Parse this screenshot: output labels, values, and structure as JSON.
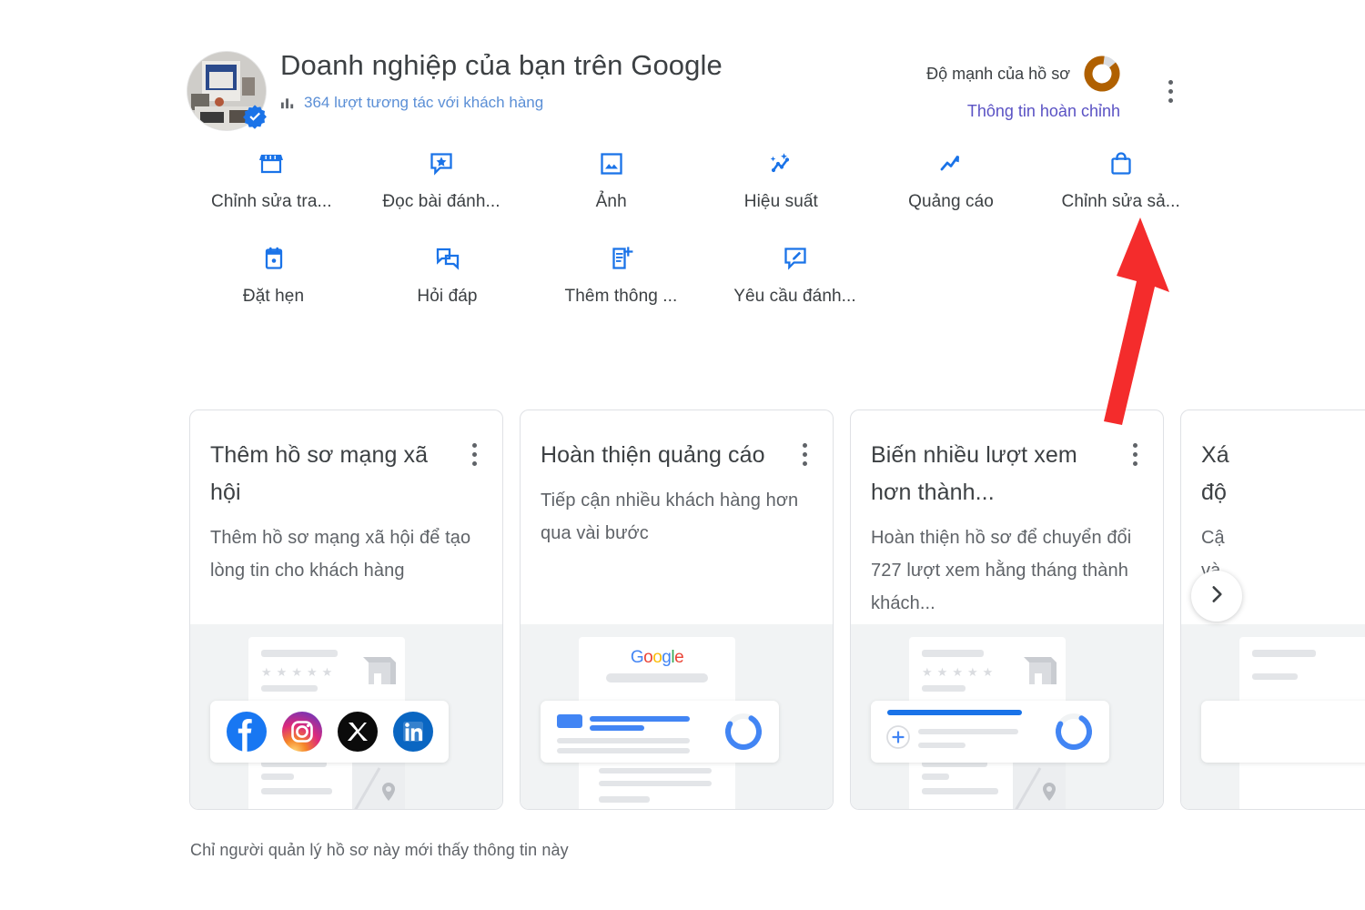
{
  "header": {
    "title": "Doanh nghiệp của bạn trên Google",
    "interactions_text": "364 lượt tương tác với khách hàng",
    "bars_icon": "bar-chart-icon",
    "verified_icon": "verified-badge-icon",
    "avatar_alt": "business-profile-photo",
    "strength_label": "Độ mạnh của hồ sơ",
    "strength_link": "Thông tin hoàn chỉnh",
    "strength_ring_color": "#B06000",
    "strength_ring_track": "#DADCE0",
    "strength_percent": 88,
    "kebab_icon": "more-options-icon"
  },
  "actions": {
    "row1": [
      {
        "label": "Chỉnh sửa tra...",
        "icon": "storefront-icon"
      },
      {
        "label": "Đọc bài đánh...",
        "icon": "review-star-bubble-icon"
      },
      {
        "label": "Ảnh",
        "icon": "photo-icon"
      },
      {
        "label": "Hiệu suất",
        "icon": "performance-sparkle-icon"
      },
      {
        "label": "Quảng cáo",
        "icon": "trending-up-icon"
      },
      {
        "label": "Chỉnh sửa sả...",
        "icon": "shopping-bag-icon"
      }
    ],
    "row2": [
      {
        "label": "Đặt hẹn",
        "icon": "calendar-icon"
      },
      {
        "label": "Hỏi đáp",
        "icon": "question-answer-icon"
      },
      {
        "label": "Thêm thông ...",
        "icon": "add-note-icon"
      },
      {
        "label": "Yêu cầu đánh...",
        "icon": "request-review-icon"
      }
    ],
    "icon_color": "#1a73e8"
  },
  "cards": [
    {
      "title": "Thêm hồ sơ mạng xã hội",
      "desc": "Thêm hồ sơ mạng xã hội để tạo lòng tin cho khách hàng",
      "illustration": "social-profiles-illustration",
      "socials": [
        "facebook-icon",
        "instagram-icon",
        "x-twitter-icon",
        "linkedin-icon"
      ]
    },
    {
      "title": "Hoàn thiện quảng cáo",
      "desc": "Tiếp cận nhiều khách hàng hơn qua vài bước",
      "illustration": "google-ads-illustration",
      "google_logo": [
        "G",
        "o",
        "o",
        "g",
        "l",
        "e"
      ]
    },
    {
      "title": "Biến nhiều lượt xem hơn thành...",
      "desc": "Hoàn thiện hồ sơ để chuyển đổi 727 lượt xem hằng tháng thành khách...",
      "illustration": "complete-profile-illustration"
    },
    {
      "title_l1": "Xá",
      "title_l2": "độ",
      "desc_l1": "Cậ",
      "desc_l2": "và",
      "illustration": "partial-card-illustration"
    }
  ],
  "next_button": {
    "icon": "chevron-right-icon",
    "label": "Tiếp theo"
  },
  "footnote": "Chỉ người quản lý hồ sơ này mới thấy thông tin này",
  "annotation": {
    "type": "red-arrow",
    "color": "#F42C2C",
    "points_to": "Chỉnh sửa sả..."
  }
}
